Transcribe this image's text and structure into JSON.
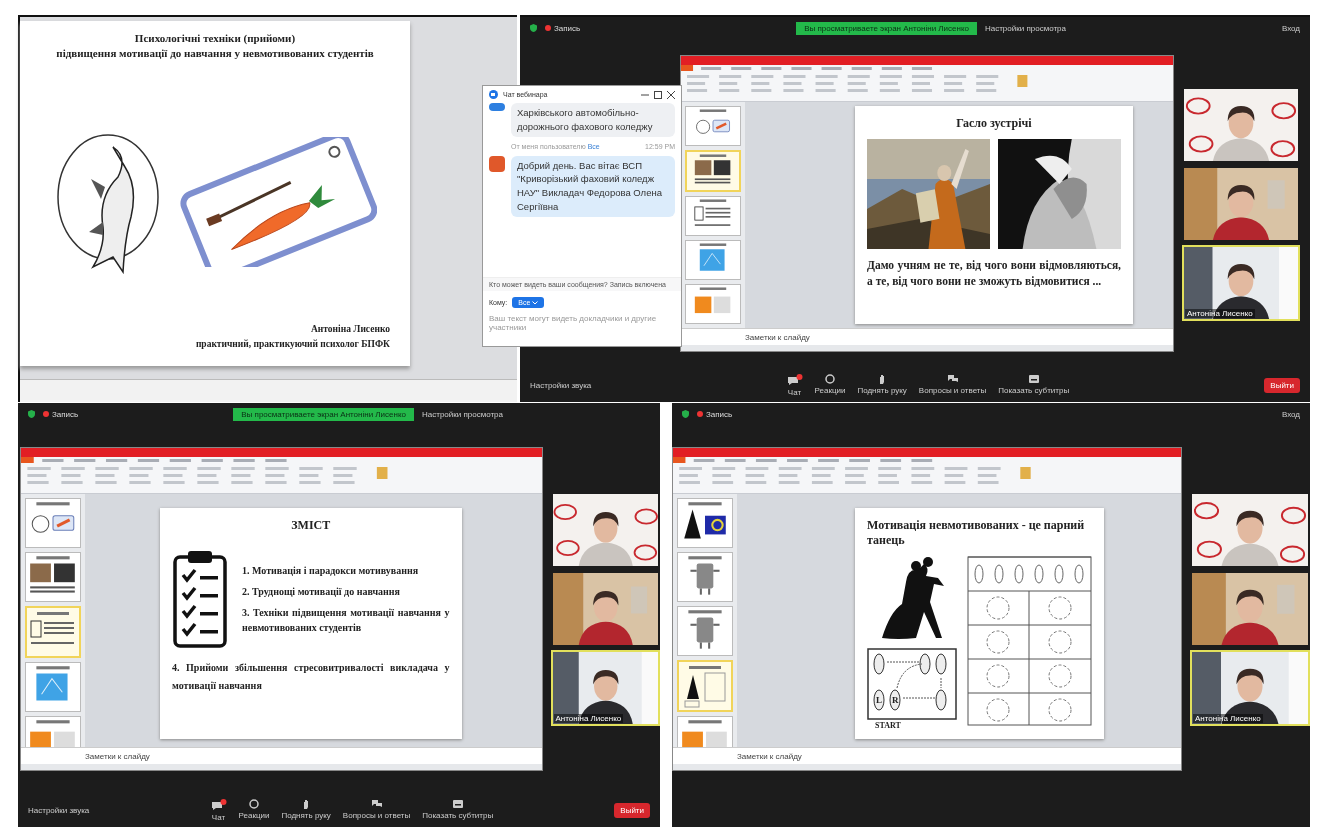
{
  "presentation": {
    "title_lines": [
      "Психологічні техніки (прийоми)",
      "підвищення мотивації до навчання у невмотивованих студентів"
    ],
    "author_lines": [
      "Антоніна Лисенко",
      "практичний,  практикуючий психолог БПФК"
    ]
  },
  "chat": {
    "title": "Чат вебинара",
    "messages": [
      {
        "kind": "other",
        "text": "Харківського автомобільно-дорожнього фахового коледжу"
      },
      {
        "kind": "mine",
        "sender": "От меня пользователю",
        "recipient": "Все",
        "time": "12:59 PM",
        "text": "Добрий день. Вас вітає ВСП \"Криворізький фаховий коледж НАУ\" Викладач Федорова Олена Сергіївна"
      }
    ],
    "privacy_note": "Кто может видеть ваши сообщения? Запись включена",
    "to_label": "Кому:",
    "to_value": "Все",
    "placeholder": "Ваш текст могут видеть докладчики и другие участники"
  },
  "meetings": [
    {
      "recording": "Запись",
      "banner": "Вы просматриваете экран Антоніни Лисенко",
      "view_settings": "Настройки просмотра",
      "sign_in": "Вход",
      "thumbnails": [
        {
          "kind": "fish",
          "selected": false
        },
        {
          "kind": "photos",
          "selected": true
        },
        {
          "kind": "list",
          "selected": false
        },
        {
          "kind": "blue",
          "selected": false
        },
        {
          "kind": "orange",
          "selected": false
        }
      ],
      "slide": {
        "kind": "quote",
        "title": "Гасло зустрічі",
        "text": "Дамо учням не те, від чого вони відмовляються, а те, від чого вони не зможуть відмовитися ..."
      },
      "notes": "Заметки к слайду",
      "participants": [
        {
          "active": false
        },
        {
          "active": false
        },
        {
          "name": "Антоніна Лисенко",
          "active": true
        }
      ],
      "audio_settings": "Настройки звука",
      "toolbar": [
        {
          "kind": "chat",
          "label": "Чат"
        },
        {
          "kind": "reactions",
          "label": "Реакции"
        },
        {
          "kind": "hand",
          "label": "Поднять руку"
        },
        {
          "kind": "qa",
          "label": "Вопросы и ответы"
        },
        {
          "kind": "captions",
          "label": "Показать субтитры"
        }
      ],
      "leave": "Выйти"
    },
    {
      "recording": "Запись",
      "banner": "Вы просматриваете экран Антоніни Лисенко",
      "view_settings": "Настройки просмотра",
      "thumbnails": [
        {
          "kind": "fish",
          "selected": false
        },
        {
          "kind": "photos",
          "selected": false
        },
        {
          "kind": "list",
          "selected": true
        },
        {
          "kind": "blue",
          "selected": false
        },
        {
          "kind": "orange",
          "selected": false
        }
      ],
      "slide": {
        "kind": "contents",
        "title": "ЗМІСТ",
        "items": [
          "1. Мотивація і парадокси мотивування",
          "2. Труднощі мотивації до навчання",
          "3. Техніки підвищення мотивації навчання у невмотивованих студентів"
        ],
        "extra_item": "4. Прийоми збільшення  стресовитривалості викладача  у мотивації навчання"
      },
      "notes": "Заметки к слайду",
      "participants": [
        {
          "active": false
        },
        {
          "active": false
        },
        {
          "name": "Антоніна Лисенко",
          "active": true
        }
      ],
      "audio_settings": "Настройки звука",
      "toolbar": [
        {
          "kind": "chat",
          "label": "Чат"
        },
        {
          "kind": "reactions",
          "label": "Реакции"
        },
        {
          "kind": "hand",
          "label": "Поднять руку"
        },
        {
          "kind": "qa",
          "label": "Вопросы и ответы"
        },
        {
          "kind": "captions",
          "label": "Показать субтитры"
        }
      ],
      "leave": "Выйти"
    },
    {
      "recording": "Запись",
      "sign_in": "Вход",
      "thumbnails": [
        {
          "kind": "dark",
          "selected": false
        },
        {
          "kind": "robot",
          "selected": false
        },
        {
          "kind": "robot",
          "selected": false
        },
        {
          "kind": "dance",
          "selected": true
        },
        {
          "kind": "orange",
          "selected": false
        }
      ],
      "slide": {
        "kind": "dance",
        "title": "Мотивація невмотивованих - це парний танець",
        "diagram_labels": [
          "L",
          "R",
          "START"
        ]
      },
      "notes": "Заметки к слайду",
      "participants": [
        {
          "active": false
        },
        {
          "active": false
        },
        {
          "name": "Антоніна Лисенко",
          "active": true
        }
      ]
    }
  ]
}
